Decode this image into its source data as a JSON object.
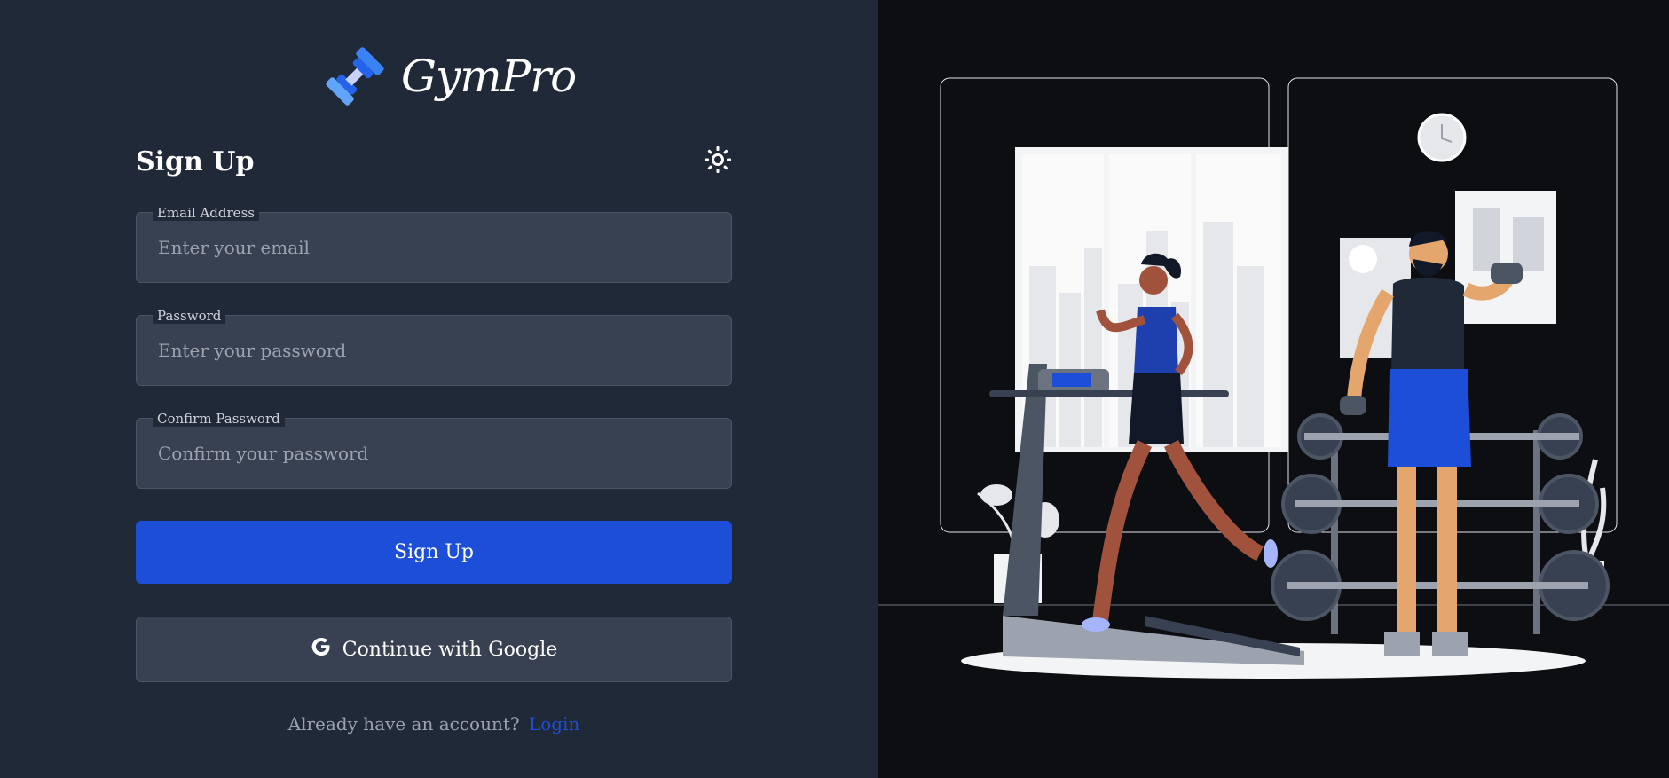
{
  "brand": {
    "name": "GymPro",
    "logo_icon": "dumbbell-icon"
  },
  "form": {
    "title": "Sign Up",
    "theme_toggle_icon": "sun-icon",
    "email": {
      "label": "Email Address",
      "placeholder": "Enter your email",
      "value": ""
    },
    "password": {
      "label": "Password",
      "placeholder": "Enter your password",
      "value": ""
    },
    "confirm_password": {
      "label": "Confirm Password",
      "placeholder": "Confirm your password",
      "value": ""
    },
    "submit_label": "Sign Up",
    "google_label": "Continue with Google",
    "google_icon": "google-icon",
    "footer_text": "Already have an account?",
    "login_link": "Login"
  },
  "colors": {
    "primary": "#1d4ed8",
    "panel_bg": "#1f2937",
    "field_bg": "#374151",
    "illustration_bg": "#0d0e12"
  }
}
